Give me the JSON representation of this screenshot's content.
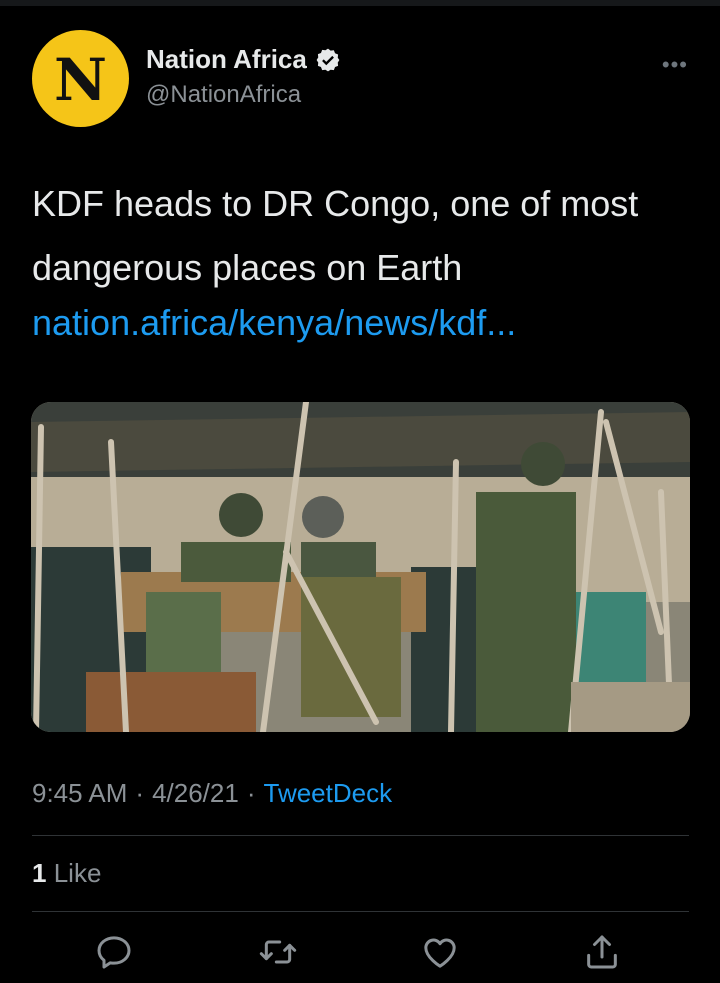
{
  "author": {
    "avatar_letter": "N",
    "display_name": "Nation Africa",
    "handle": "@NationAfrica",
    "verified": true
  },
  "tweet": {
    "text": "KDF heads to DR Congo, one of most dangerous places on Earth",
    "link": "nation.africa/kenya/news/kdf..."
  },
  "meta": {
    "time": "9:45 AM",
    "separator": "·",
    "date": "4/26/21",
    "source": "TweetDeck"
  },
  "engagement": {
    "like_count": "1",
    "like_label": "Like"
  },
  "actions": [
    "reply-icon",
    "retweet-icon",
    "like-icon",
    "share-icon"
  ],
  "colors": {
    "background": "#000000",
    "text": "#e7e9ea",
    "secondary": "#8b9196",
    "link": "#1d9bf0",
    "avatar_bg": "#f5c518"
  }
}
